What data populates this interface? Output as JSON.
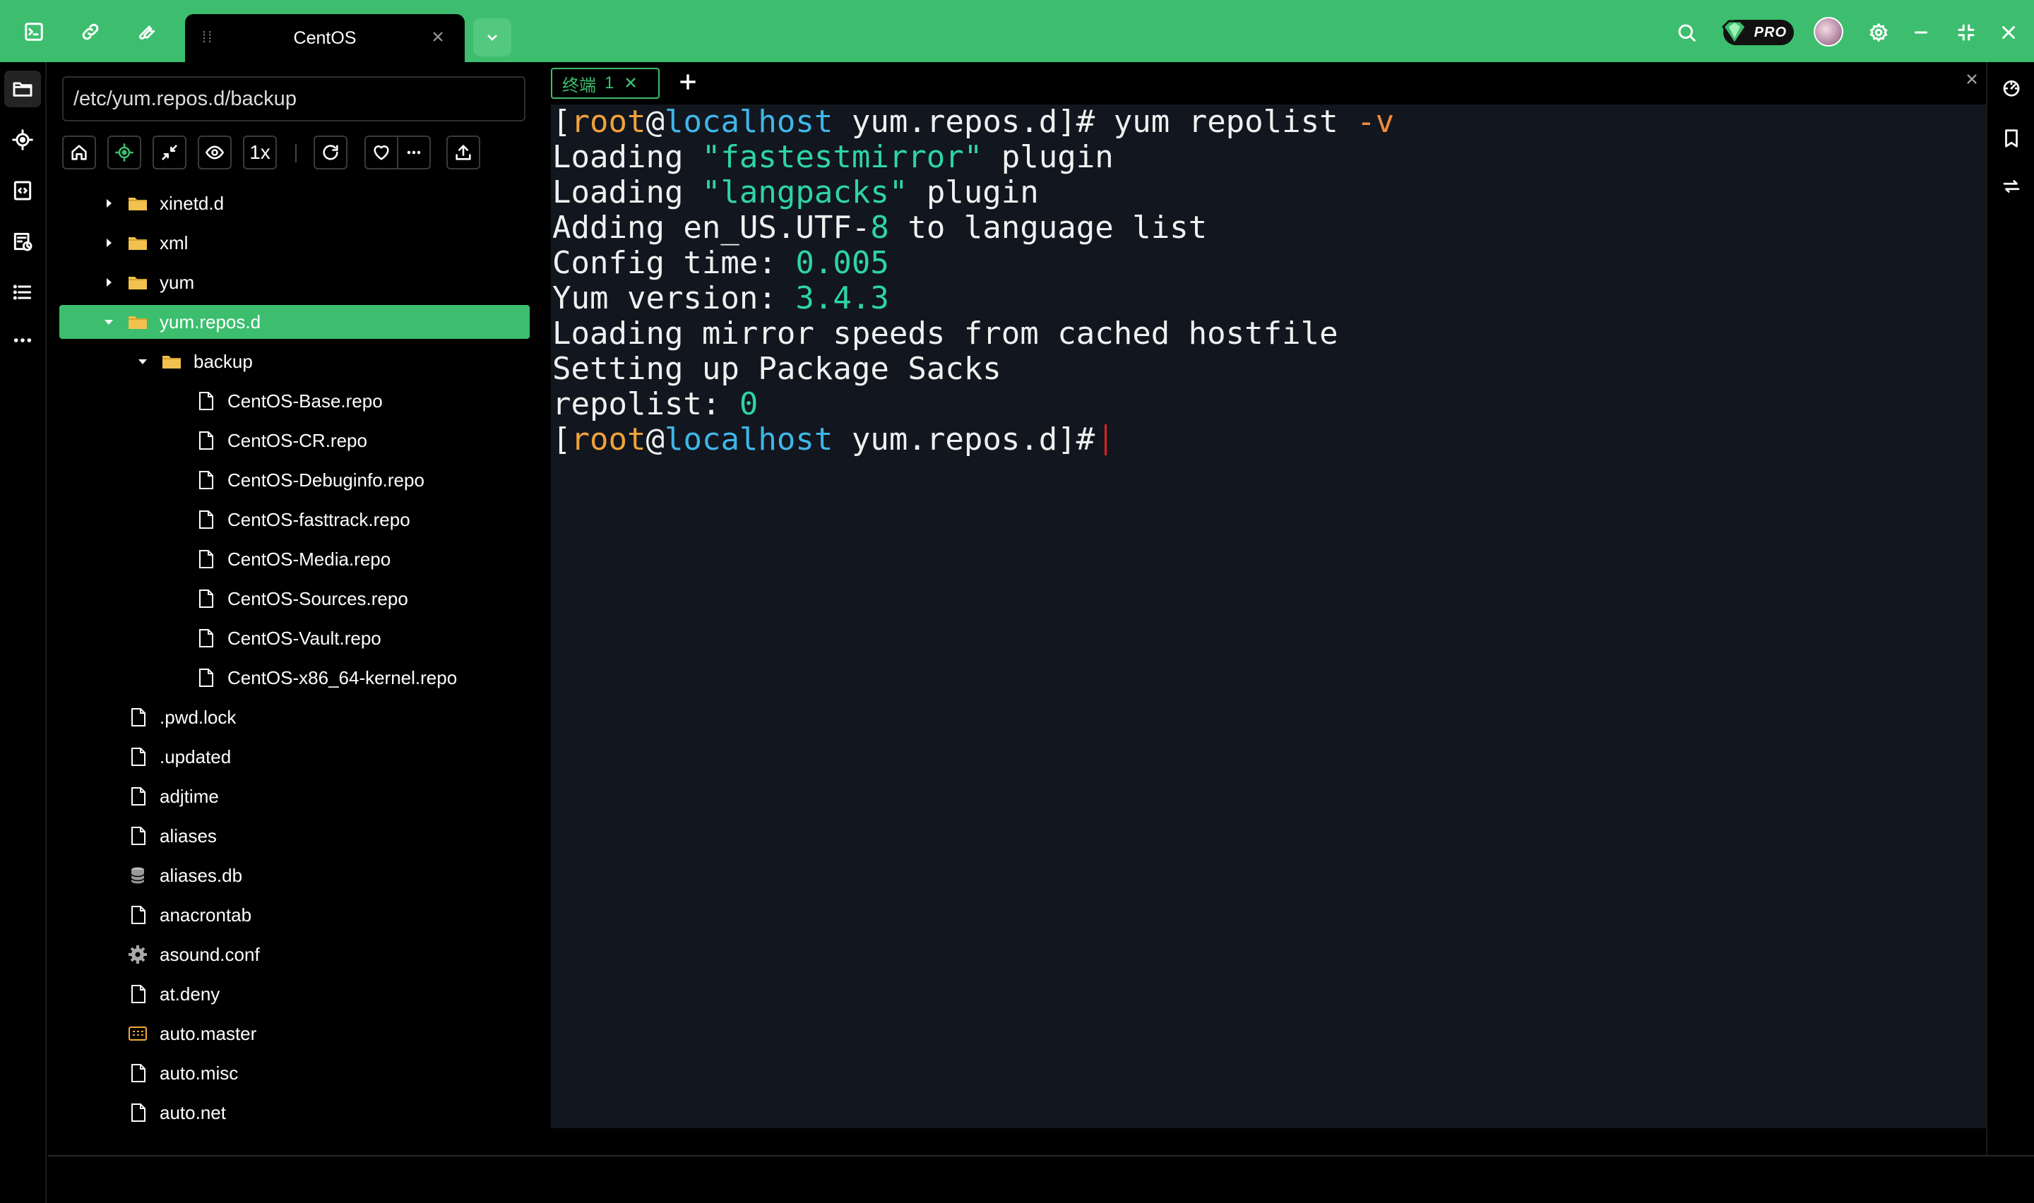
{
  "topbar": {
    "tab_title": "CentOS",
    "pro_label": "PRO",
    "icons": [
      "terminal-icon",
      "link-icon",
      "wrench-icon",
      "search-icon",
      "gem-icon",
      "avatar",
      "settings-icon",
      "minimize-icon",
      "restore-icon",
      "close-icon"
    ]
  },
  "filepanel": {
    "path": "/etc/yum.repos.d/backup",
    "toolbar": {
      "speed_label": "1x"
    },
    "tree": [
      {
        "name": "xinetd.d",
        "type": "folder",
        "depth": 0,
        "expanded": false
      },
      {
        "name": "xml",
        "type": "folder",
        "depth": 0,
        "expanded": false
      },
      {
        "name": "yum",
        "type": "folder",
        "depth": 0,
        "expanded": false
      },
      {
        "name": "yum.repos.d",
        "type": "folder",
        "depth": 0,
        "expanded": true,
        "selected": true
      },
      {
        "name": "backup",
        "type": "folder",
        "depth": 1,
        "expanded": true
      },
      {
        "name": "CentOS-Base.repo",
        "type": "file",
        "depth": 2
      },
      {
        "name": "CentOS-CR.repo",
        "type": "file",
        "depth": 2
      },
      {
        "name": "CentOS-Debuginfo.repo",
        "type": "file",
        "depth": 2
      },
      {
        "name": "CentOS-fasttrack.repo",
        "type": "file",
        "depth": 2
      },
      {
        "name": "CentOS-Media.repo",
        "type": "file",
        "depth": 2
      },
      {
        "name": "CentOS-Sources.repo",
        "type": "file",
        "depth": 2
      },
      {
        "name": "CentOS-Vault.repo",
        "type": "file",
        "depth": 2
      },
      {
        "name": "CentOS-x86_64-kernel.repo",
        "type": "file",
        "depth": 2
      },
      {
        "name": ".pwd.lock",
        "type": "file",
        "depth": 0
      },
      {
        "name": ".updated",
        "type": "file",
        "depth": 0
      },
      {
        "name": "adjtime",
        "type": "file",
        "depth": 0
      },
      {
        "name": "aliases",
        "type": "file",
        "depth": 0
      },
      {
        "name": "aliases.db",
        "type": "database",
        "depth": 0
      },
      {
        "name": "anacrontab",
        "type": "file",
        "depth": 0
      },
      {
        "name": "asound.conf",
        "type": "config",
        "depth": 0
      },
      {
        "name": "at.deny",
        "type": "file",
        "depth": 0
      },
      {
        "name": "auto.master",
        "type": "table",
        "depth": 0
      },
      {
        "name": "auto.misc",
        "type": "file",
        "depth": 0
      },
      {
        "name": "auto.net",
        "type": "file",
        "depth": 0
      }
    ]
  },
  "terminal": {
    "tab_label": "终端",
    "tab_number": "1",
    "lines": [
      [
        {
          "t": "["
        },
        {
          "t": "root",
          "c": "user"
        },
        {
          "t": "@"
        },
        {
          "t": "localhost",
          "c": "host"
        },
        {
          "t": " yum.repos.d]# yum repolist "
        },
        {
          "t": "-v",
          "c": "flag"
        }
      ],
      [
        {
          "t": "Loading "
        },
        {
          "t": "\"fastestmirror\"",
          "c": "num"
        },
        {
          "t": " plugin"
        }
      ],
      [
        {
          "t": "Loading "
        },
        {
          "t": "\"langpacks\"",
          "c": "num"
        },
        {
          "t": " plugin"
        }
      ],
      [
        {
          "t": "Adding en_US.UTF-"
        },
        {
          "t": "8",
          "c": "num"
        },
        {
          "t": " to language list"
        }
      ],
      [
        {
          "t": "Config time: "
        },
        {
          "t": "0.005",
          "c": "num"
        }
      ],
      [
        {
          "t": "Yum version: "
        },
        {
          "t": "3.4.3",
          "c": "num"
        }
      ],
      [
        {
          "t": "Loading mirror speeds from cached hostfile"
        }
      ],
      [
        {
          "t": "Setting up Package Sacks"
        }
      ],
      [
        {
          "t": "repolist: "
        },
        {
          "t": "0",
          "c": "num"
        }
      ],
      [
        {
          "t": "["
        },
        {
          "t": "root",
          "c": "user"
        },
        {
          "t": "@"
        },
        {
          "t": "localhost",
          "c": "host"
        },
        {
          "t": " yum.repos.d]#"
        }
      ]
    ]
  },
  "colors": {
    "accent": "#3cbe6e",
    "terminal_bg": "#12161e",
    "prompt_user": "#f0a23b",
    "prompt_host": "#3fb6e8",
    "number": "#2dd4a6",
    "flag": "#f08a3c",
    "folder": "#f2c14e"
  }
}
